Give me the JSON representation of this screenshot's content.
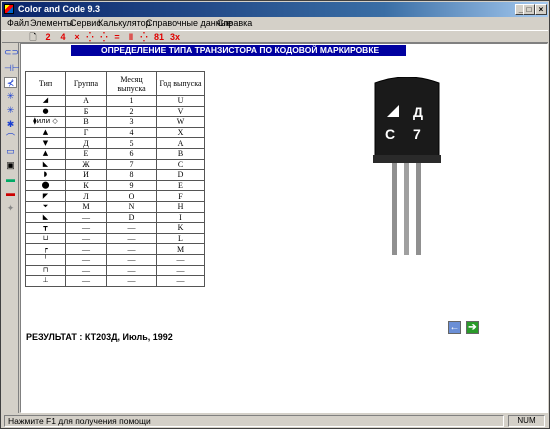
{
  "window": {
    "title": "Color and Code 9.3",
    "controls": [
      "_",
      "□",
      "×"
    ]
  },
  "menu": [
    "Файл",
    "Элементы",
    "Сервис",
    "Калькулятор",
    "Справочные данные",
    "Справка"
  ],
  "toolbar": [
    "2",
    "4",
    "×",
    "⁛",
    "⁛",
    "=",
    "ǁ",
    "⁛",
    "81",
    "3x"
  ],
  "left_toolbar_icons": [
    "⊂⊃",
    "⊣⊢",
    "⊀",
    "✳",
    "✳",
    "✱",
    "⌒",
    "▭",
    "▣",
    "▬",
    "▬",
    "✦"
  ],
  "banner": "ОПРЕДЕЛЕНИЕ ТИПА ТРАНЗИСТОРА ПО КОДОВОЙ МАРКИРОВКЕ",
  "table": {
    "headers": [
      "Тип",
      "Группа",
      "Месяц выпуска",
      "Год выпуска"
    ],
    "rows": [
      [
        "◢",
        "А",
        "1",
        "U"
      ],
      [
        "●",
        "Б",
        "2",
        "V"
      ],
      [
        "⧫или ◇",
        "В",
        "3",
        "W"
      ],
      [
        "▲",
        "Г",
        "4",
        "X"
      ],
      [
        "▼",
        "Д",
        "5",
        "A"
      ],
      [
        "▲",
        "Е",
        "6",
        "B"
      ],
      [
        "◣",
        "Ж",
        "7",
        "C"
      ],
      [
        "◗",
        "И",
        "8",
        "D"
      ],
      [
        "⬤",
        "К",
        "9",
        "E"
      ],
      [
        "◤",
        "Л",
        "O",
        "F"
      ],
      [
        "⏷",
        "М",
        "N",
        "H"
      ],
      [
        "◣",
        "—",
        "D",
        "I"
      ],
      [
        "┳",
        "—",
        "—",
        "K"
      ],
      [
        "⊔",
        "—",
        "—",
        "L"
      ],
      [
        "┍",
        "—",
        "—",
        "M"
      ],
      [
        "╵",
        "—",
        "—",
        "—"
      ],
      [
        "⊓",
        "—",
        "—",
        "—"
      ],
      [
        "⊥",
        "—",
        "—",
        "—"
      ]
    ]
  },
  "transistor": {
    "marking_top": "Д",
    "marking_bottom_left": "С",
    "marking_bottom_right": "7"
  },
  "result": "РЕЗУЛЬТАТ : КТ203Д, Июль, 1992",
  "status": {
    "hint": "Нажмите F1 для получения помощи",
    "num": "NUM"
  },
  "colors": {
    "banner": "#0000a0",
    "title_bar": "#0a246a",
    "toolbar_icons": "#e00000",
    "nav_back": "#6b8fd6",
    "nav_forward": "#2a9a2a"
  }
}
